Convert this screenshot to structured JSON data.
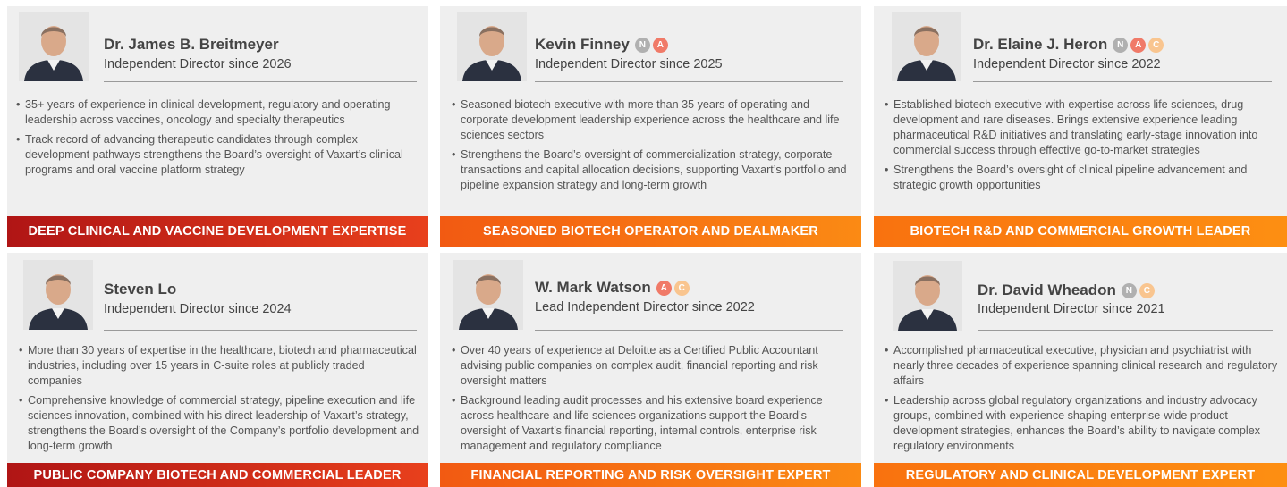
{
  "directors": [
    {
      "name": "Dr. James B. Breitmeyer",
      "title": "Independent Director since 2026",
      "badges": [],
      "bullets": [
        "35+ years of experience in clinical development, regulatory and operating leadership across vaccines, oncology and specialty therapeutics",
        "Track record of advancing therapeutic candidates through complex development pathways strengthens the Board’s oversight of Vaxart’s clinical programs and oral vaccine platform strategy"
      ],
      "banner": "DEEP CLINICAL AND VACCINE DEVELOPMENT EXPERTISE"
    },
    {
      "name": "Kevin Finney",
      "title": "Independent Director since 2025",
      "badges": [
        "N",
        "A"
      ],
      "bullets": [
        "Seasoned biotech executive with more than 35 years of operating and corporate development leadership experience across the healthcare and life sciences sectors",
        "Strengthens the Board’s oversight of commercialization strategy, corporate transactions and capital allocation decisions, supporting Vaxart’s portfolio and pipeline expansion strategy and long-term growth"
      ],
      "banner": "SEASONED BIOTECH OPERATOR AND DEALMAKER"
    },
    {
      "name": "Dr. Elaine J. Heron",
      "title": "Independent Director since 2022",
      "badges": [
        "N",
        "A",
        "C"
      ],
      "bullets": [
        "Established biotech executive with expertise across life sciences, drug development and rare diseases. Brings extensive experience leading pharmaceutical R&D initiatives and translating early-stage innovation into commercial success through effective go-to-market strategies",
        "Strengthens the Board’s oversight of clinical pipeline advancement and strategic growth opportunities"
      ],
      "banner": "BIOTECH R&D AND COMMERCIAL GROWTH LEADER"
    },
    {
      "name": "Steven Lo",
      "title": "Independent Director since 2024",
      "badges": [],
      "bullets": [
        "More than 30 years of expertise in the healthcare, biotech and pharmaceutical industries, including over 15 years in C-suite roles at publicly traded companies",
        "Comprehensive knowledge of commercial strategy, pipeline execution and life sciences innovation, combined with his direct leadership of Vaxart’s strategy, strengthens the Board’s oversight of the Company’s portfolio development and long-term growth"
      ],
      "banner": "PUBLIC COMPANY BIOTECH AND COMMERCIAL LEADER"
    },
    {
      "name": "W. Mark Watson",
      "title": "Lead Independent Director since 2022",
      "badges": [
        "A",
        "C"
      ],
      "bullets": [
        "Over 40 years of experience at Deloitte as a Certified Public Accountant advising public companies on complex audit, financial reporting and risk oversight matters",
        "Background leading audit processes and his extensive board experience across healthcare and life sciences organizations support the Board’s oversight of Vaxart’s financial reporting, internal controls, enterprise risk management and regulatory compliance"
      ],
      "banner": "FINANCIAL REPORTING AND RISK OVERSIGHT EXPERT"
    },
    {
      "name": "Dr. David Wheadon",
      "title": "Independent Director since 2021",
      "badges": [
        "N",
        "C"
      ],
      "bullets": [
        "Accomplished pharmaceutical executive, physician and psychiatrist with nearly three decades of experience spanning clinical research and regulatory affairs",
        "Leadership across global regulatory organizations and industry advocacy groups, combined with experience shaping enterprise-wide product development strategies, enhances the Board’s ability to navigate complex regulatory environments"
      ],
      "banner": "REGULATORY AND CLINICAL DEVELOPMENT EXPERT"
    }
  ],
  "colors": {
    "card_bg": "#efefef",
    "red": "#c41a17",
    "orange": "#f7660f",
    "badge_n": "#b0b0b0",
    "badge_a": "#f07a68",
    "badge_c": "#f9c58f"
  }
}
